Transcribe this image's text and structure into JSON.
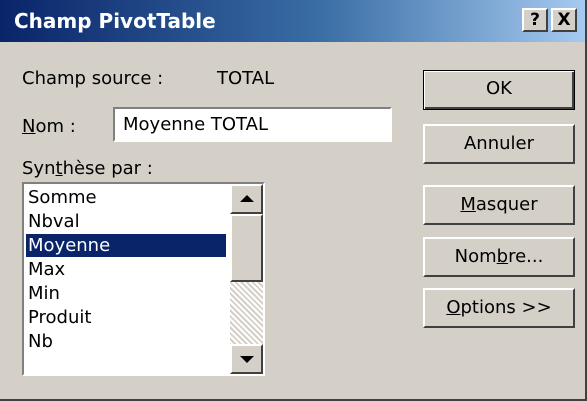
{
  "window": {
    "title": "Champ PivotTable",
    "help_label": "?",
    "close_label": "X"
  },
  "source_field": {
    "label": "Champ source :",
    "value": "TOTAL"
  },
  "name_field": {
    "label_underlined": "N",
    "label_rest": "om :",
    "value": "Moyenne TOTAL"
  },
  "summarize_by": {
    "label_pre": "Syn",
    "label_underlined": "t",
    "label_post": "hèse par :",
    "items": [
      "Somme",
      "Nbval",
      "Moyenne",
      "Max",
      "Min",
      "Produit",
      "Nb"
    ],
    "selected": "Moyenne"
  },
  "buttons": {
    "ok": "OK",
    "cancel": "Annuler",
    "hide_underlined": "M",
    "hide_rest": "asquer",
    "number_pre": "Nom",
    "number_underlined": "b",
    "number_post": "re...",
    "options_underlined": "O",
    "options_rest": "ptions >>"
  },
  "colors": {
    "title_bar_start": "#0a246a",
    "selection": "#0a246a",
    "dialog_face": "#d4d0c8"
  }
}
